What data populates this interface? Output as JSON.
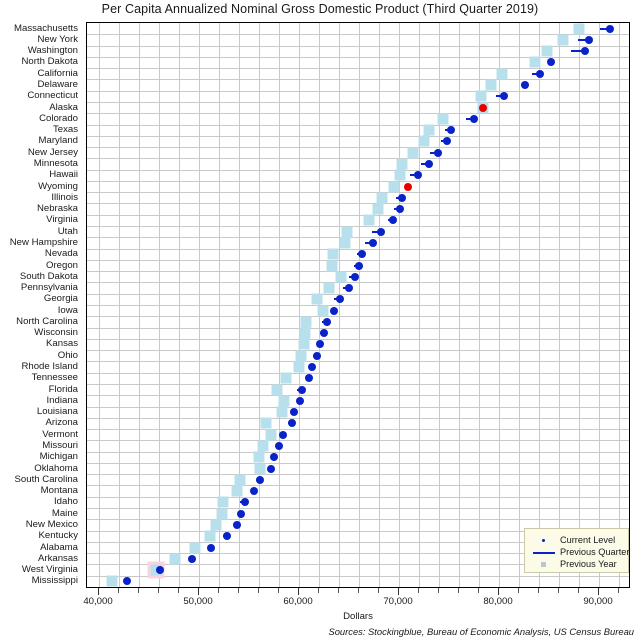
{
  "chart_data": {
    "type": "scatter",
    "title": "Per Capita Annualized Nominal Gross Domestic Product (Third Quarter 2019)",
    "xlabel": "Dollars",
    "ylabel": "",
    "xlim": [
      38800,
      93000
    ],
    "xticks": [
      40000,
      50000,
      60000,
      70000,
      80000,
      90000
    ],
    "xticklabels": [
      "40,000",
      "50,000",
      "60,000",
      "70,000",
      "80,000",
      "90,000"
    ],
    "minor_tick_step": 2000,
    "grid": true,
    "legend_position": "bottom-right",
    "colors": {
      "current_level": "#0a23c8",
      "current_level_decline": "#e80000",
      "previous_quarter": "#0a23c8",
      "previous_year": "#b8e0ec",
      "previous_year_highlight": "#fbd3de",
      "grid": "#c9c9c9",
      "axis": "#000000",
      "legend_background": "#fbfbe8"
    },
    "series": [
      {
        "name": "Current Level",
        "marker": "dot"
      },
      {
        "name": "Previous Quarter",
        "marker": "line"
      },
      {
        "name": "Previous Year",
        "marker": "square"
      }
    ],
    "categories": [
      "Massachusetts",
      "New York",
      "Washington",
      "North Dakota",
      "California",
      "Delaware",
      "Connecticut",
      "Alaska",
      "Colorado",
      "Texas",
      "Maryland",
      "New Jersey",
      "Minnesota",
      "Hawaii",
      "Wyoming",
      "Illinois",
      "Nebraska",
      "Virginia",
      "Utah",
      "New Hampshire",
      "Nevada",
      "Oregon",
      "South Dakota",
      "Pennsylvania",
      "Georgia",
      "Iowa",
      "North Carolina",
      "Wisconsin",
      "Kansas",
      "Ohio",
      "Rhode Island",
      "Tennessee",
      "Florida",
      "Indiana",
      "Louisiana",
      "Arizona",
      "Vermont",
      "Missouri",
      "Michigan",
      "Oklahoma",
      "South Carolina",
      "Montana",
      "Idaho",
      "Maine",
      "New Mexico",
      "Kentucky",
      "Alabama",
      "Arkansas",
      "West Virginia",
      "Mississippi"
    ],
    "data": [
      {
        "state": "Massachusetts",
        "current": 91100,
        "previous_quarter": 90100,
        "previous_year": 88000,
        "declined": false
      },
      {
        "state": "New York",
        "current": 89000,
        "previous_quarter": 87900,
        "previous_year": 86400,
        "declined": false
      },
      {
        "state": "Washington",
        "current": 88600,
        "previous_quarter": 87200,
        "previous_year": 84800,
        "declined": false
      },
      {
        "state": "North Dakota",
        "current": 85200,
        "previous_quarter": 85100,
        "previous_year": 83600,
        "declined": false
      },
      {
        "state": "California",
        "current": 84100,
        "previous_quarter": 83300,
        "previous_year": 80300,
        "declined": false
      },
      {
        "state": "Delaware",
        "current": 82600,
        "previous_quarter": 82200,
        "previous_year": 79200,
        "declined": false
      },
      {
        "state": "Connecticut",
        "current": 80500,
        "previous_quarter": 79700,
        "previous_year": 78200,
        "declined": false
      },
      {
        "state": "Alaska",
        "current": 78400,
        "previous_quarter": 78700,
        "previous_year": 78400,
        "declined": true
      },
      {
        "state": "Colorado",
        "current": 77500,
        "previous_quarter": 76700,
        "previous_year": 74400,
        "declined": false
      },
      {
        "state": "Texas",
        "current": 75200,
        "previous_quarter": 74600,
        "previous_year": 73000,
        "declined": false
      },
      {
        "state": "Maryland",
        "current": 74800,
        "previous_quarter": 74200,
        "previous_year": 72500,
        "declined": false
      },
      {
        "state": "New Jersey",
        "current": 73900,
        "previous_quarter": 73100,
        "previous_year": 71400,
        "declined": false
      },
      {
        "state": "Minnesota",
        "current": 73000,
        "previous_quarter": 72200,
        "previous_year": 70300,
        "declined": false
      },
      {
        "state": "Hawaii",
        "current": 71900,
        "previous_quarter": 71100,
        "previous_year": 70100,
        "declined": false
      },
      {
        "state": "Wyoming",
        "current": 70900,
        "previous_quarter": 71200,
        "previous_year": 69500,
        "declined": true
      },
      {
        "state": "Illinois",
        "current": 70300,
        "previous_quarter": 69700,
        "previous_year": 68300,
        "declined": false
      },
      {
        "state": "Nebraska",
        "current": 70100,
        "previous_quarter": 69500,
        "previous_year": 67900,
        "declined": false
      },
      {
        "state": "Virginia",
        "current": 69400,
        "previous_quarter": 68900,
        "previous_year": 67000,
        "declined": false
      },
      {
        "state": "Utah",
        "current": 68200,
        "previous_quarter": 67300,
        "previous_year": 64800,
        "declined": false
      },
      {
        "state": "New Hampshire",
        "current": 67400,
        "previous_quarter": 66600,
        "previous_year": 64600,
        "declined": false
      },
      {
        "state": "Nevada",
        "current": 66300,
        "previous_quarter": 65800,
        "previous_year": 63400,
        "declined": false
      },
      {
        "state": "Oregon",
        "current": 66000,
        "previous_quarter": 65500,
        "previous_year": 63300,
        "declined": false
      },
      {
        "state": "South Dakota",
        "current": 65600,
        "previous_quarter": 65000,
        "previous_year": 64200,
        "declined": false
      },
      {
        "state": "Pennsylvania",
        "current": 65000,
        "previous_quarter": 64400,
        "previous_year": 63000,
        "declined": false
      },
      {
        "state": "Georgia",
        "current": 64100,
        "previous_quarter": 63500,
        "previous_year": 61800,
        "declined": false
      },
      {
        "state": "Iowa",
        "current": 63500,
        "previous_quarter": 63200,
        "previous_year": 62400,
        "declined": false
      },
      {
        "state": "North Carolina",
        "current": 62800,
        "previous_quarter": 62300,
        "previous_year": 60700,
        "declined": false
      },
      {
        "state": "Wisconsin",
        "current": 62500,
        "previous_quarter": 62100,
        "previous_year": 60600,
        "declined": false
      },
      {
        "state": "Kansas",
        "current": 62100,
        "previous_quarter": 61800,
        "previous_year": 60500,
        "declined": false
      },
      {
        "state": "Ohio",
        "current": 61800,
        "previous_quarter": 61400,
        "previous_year": 60200,
        "declined": false
      },
      {
        "state": "Rhode Island",
        "current": 61300,
        "previous_quarter": 61100,
        "previous_year": 60000,
        "declined": false
      },
      {
        "state": "Tennessee",
        "current": 61000,
        "previous_quarter": 60600,
        "previous_year": 58700,
        "declined": false
      },
      {
        "state": "Florida",
        "current": 60300,
        "previous_quarter": 59800,
        "previous_year": 57800,
        "declined": false
      },
      {
        "state": "Indiana",
        "current": 60100,
        "previous_quarter": 59800,
        "previous_year": 58500,
        "declined": false
      },
      {
        "state": "Louisiana",
        "current": 59500,
        "previous_quarter": 59100,
        "previous_year": 58300,
        "declined": false
      },
      {
        "state": "Arizona",
        "current": 59300,
        "previous_quarter": 58900,
        "previous_year": 56700,
        "declined": false
      },
      {
        "state": "Vermont",
        "current": 58400,
        "previous_quarter": 58200,
        "previous_year": 57200,
        "declined": false
      },
      {
        "state": "Missouri",
        "current": 58000,
        "previous_quarter": 57700,
        "previous_year": 56400,
        "declined": false
      },
      {
        "state": "Michigan",
        "current": 57500,
        "previous_quarter": 57200,
        "previous_year": 56000,
        "declined": false
      },
      {
        "state": "Oklahoma",
        "current": 57200,
        "previous_quarter": 57000,
        "previous_year": 56100,
        "declined": false
      },
      {
        "state": "South Carolina",
        "current": 56100,
        "previous_quarter": 55700,
        "previous_year": 54100,
        "declined": false
      },
      {
        "state": "Montana",
        "current": 55500,
        "previous_quarter": 55200,
        "previous_year": 53800,
        "declined": false
      },
      {
        "state": "Idaho",
        "current": 54600,
        "previous_quarter": 54100,
        "previous_year": 52400,
        "declined": false
      },
      {
        "state": "Maine",
        "current": 54200,
        "previous_quarter": 53900,
        "previous_year": 52300,
        "declined": false
      },
      {
        "state": "New Mexico",
        "current": 53800,
        "previous_quarter": 53600,
        "previous_year": 51700,
        "declined": false
      },
      {
        "state": "Kentucky",
        "current": 52800,
        "previous_quarter": 52400,
        "previous_year": 51100,
        "declined": false
      },
      {
        "state": "Alabama",
        "current": 51200,
        "previous_quarter": 51000,
        "previous_year": 49600,
        "declined": false
      },
      {
        "state": "Arkansas",
        "current": 49300,
        "previous_quarter": 49100,
        "previous_year": 47600,
        "declined": false
      },
      {
        "state": "West Virginia",
        "current": 46100,
        "previous_quarter": 45800,
        "previous_year": 45700,
        "declined": false
      },
      {
        "state": "Mississippi",
        "current": 42800,
        "previous_quarter": 42600,
        "previous_year": 41300,
        "declined": false
      }
    ],
    "highlight_previous_year": [
      "West Virginia"
    ],
    "sources": "Sources: Stockingblue, Bureau of Economic Analysis, US Census Bureau"
  },
  "legend": {
    "items": [
      {
        "label": "Current Level",
        "symbol": "dot"
      },
      {
        "label": "Previous Quarter",
        "symbol": "line"
      },
      {
        "label": "Previous Year",
        "symbol": "square"
      }
    ]
  }
}
